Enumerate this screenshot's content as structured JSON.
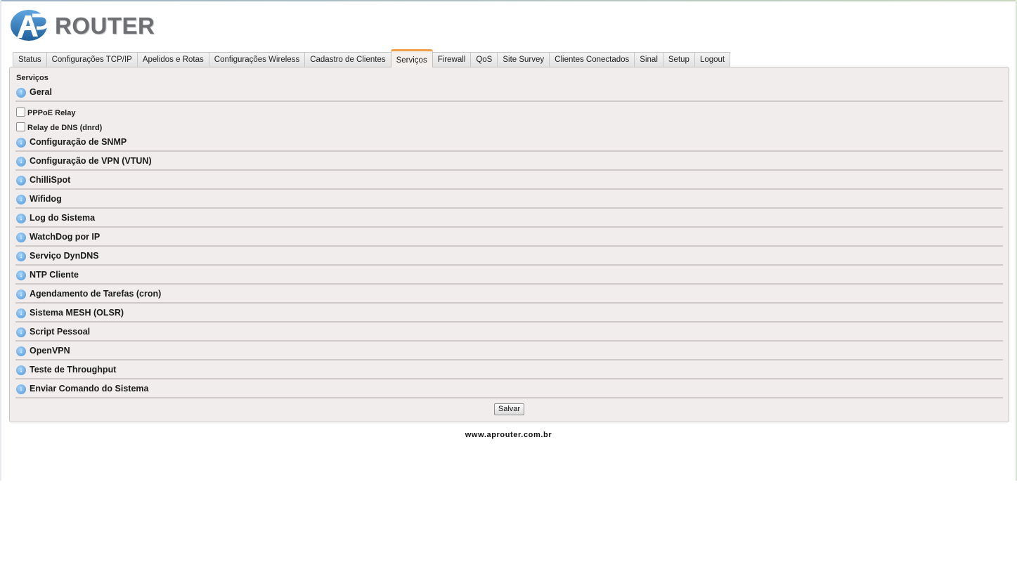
{
  "logo": {
    "text": "ROUTER"
  },
  "tabs": [
    {
      "label": "Status"
    },
    {
      "label": "Configurações TCP/IP"
    },
    {
      "label": "Apelidos e Rotas"
    },
    {
      "label": "Configurações Wireless"
    },
    {
      "label": "Cadastro de Clientes"
    },
    {
      "label": "Serviços",
      "active": true
    },
    {
      "label": "Firewall"
    },
    {
      "label": "QoS"
    },
    {
      "label": "Site Survey"
    },
    {
      "label": "Clientes Conectados"
    },
    {
      "label": "Sinal"
    },
    {
      "label": "Setup"
    },
    {
      "label": "Logout"
    }
  ],
  "panel": {
    "title": "Serviços",
    "general": {
      "label": "Geral",
      "expanded": true,
      "icon": "arrow-up-circle-icon"
    },
    "options": [
      {
        "label": "PPPoE Relay",
        "checked": false
      },
      {
        "label": "Relay de DNS (dnrd)",
        "checked": false
      }
    ],
    "sections": [
      {
        "label": "Configuração de SNMP"
      },
      {
        "label": "Configuração de VPN (VTUN)"
      },
      {
        "label": "ChilliSpot"
      },
      {
        "label": "Wifidog"
      },
      {
        "label": "Log do Sistema"
      },
      {
        "label": "WatchDog por IP"
      },
      {
        "label": "Serviço DynDNS"
      },
      {
        "label": "NTP Cliente"
      },
      {
        "label": "Agendamento de Tarefas (cron)"
      },
      {
        "label": "Sistema MESH (OLSR)"
      },
      {
        "label": "Script Pessoal"
      },
      {
        "label": "OpenVPN"
      },
      {
        "label": "Teste de Throughput"
      },
      {
        "label": "Enviar Comando do Sistema"
      }
    ],
    "save_label": "Salvar"
  },
  "footer": {
    "url": "www.aprouter.com.br"
  },
  "colors": {
    "accent": "#f0a04a",
    "icon_blue": "#4e98d8",
    "panel_bg": "#f0edec"
  }
}
